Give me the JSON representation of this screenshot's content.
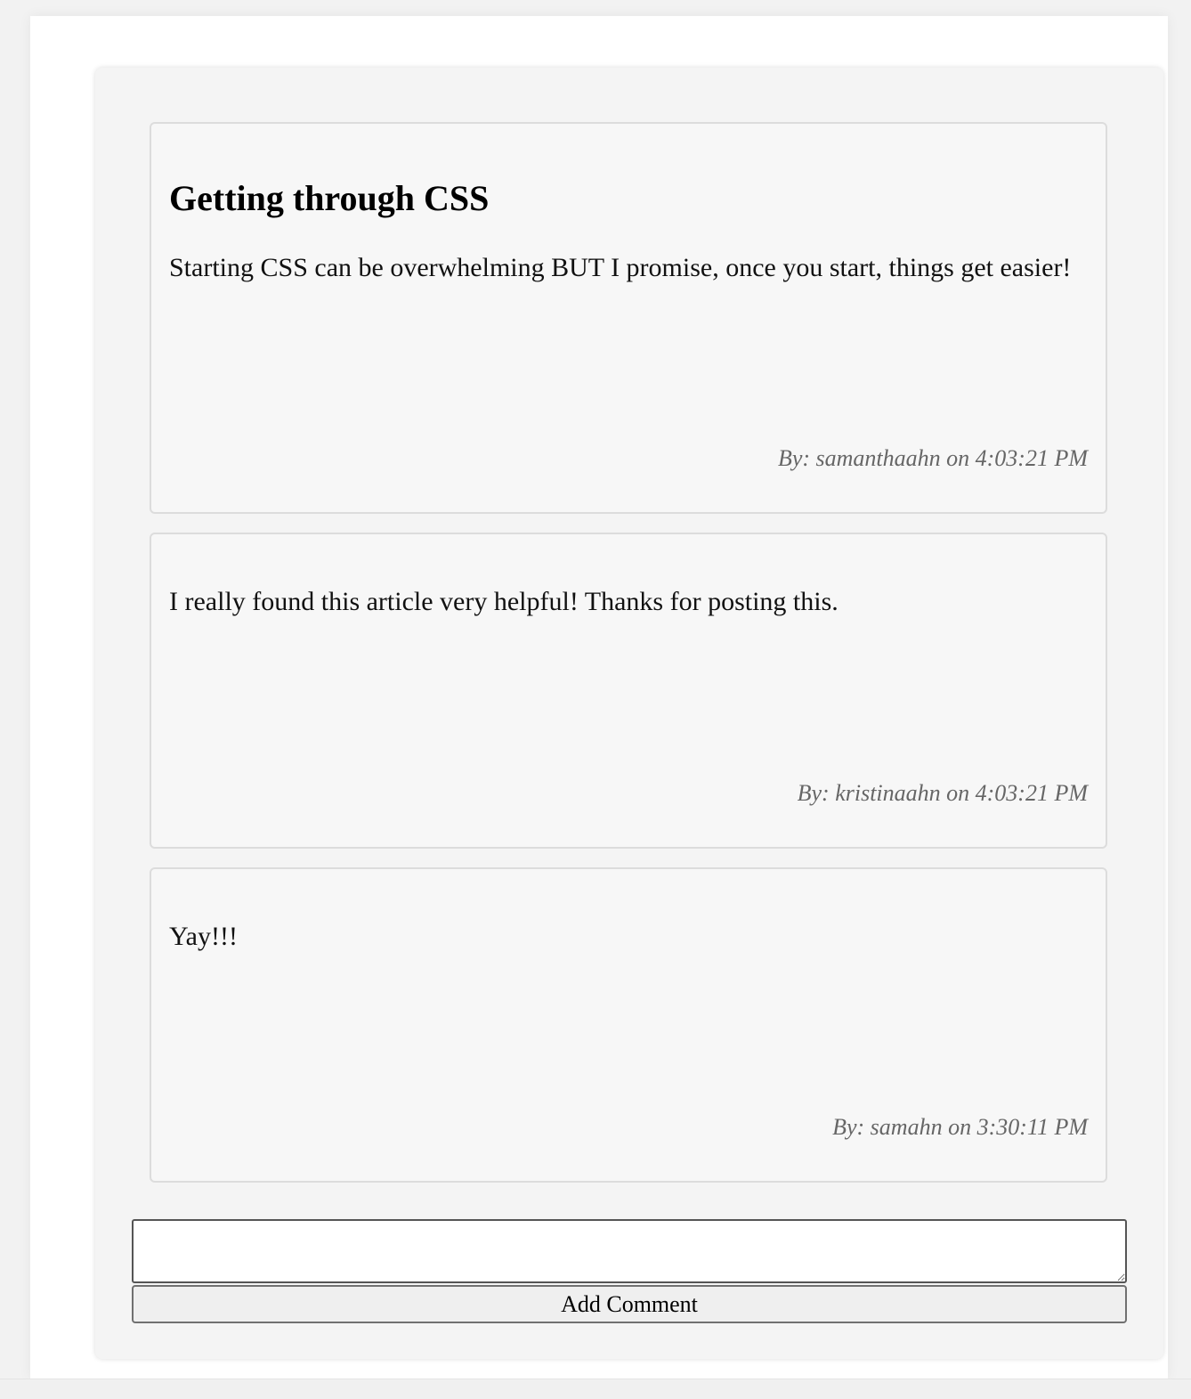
{
  "post": {
    "title": "Getting through CSS",
    "body": "Starting CSS can be overwhelming BUT I promise, once you start, things get easier!",
    "meta": "By: samanthaahn on 4:03:21 PM"
  },
  "comments": [
    {
      "body": "I really found this article very helpful! Thanks for posting this.",
      "meta": "By: kristinaahn on 4:03:21 PM"
    },
    {
      "body": "Yay!!!",
      "meta": "By: samahn on 3:30:11 PM"
    }
  ],
  "comment_form": {
    "input_value": "",
    "button_label": "Add Comment"
  },
  "colors": {
    "page_background": "#ffffff",
    "panel_background": "#f4f4f4",
    "card_background": "#f7f7f7",
    "card_border": "#dcdcdc",
    "meta_text": "#666666",
    "button_background": "#efefef"
  }
}
